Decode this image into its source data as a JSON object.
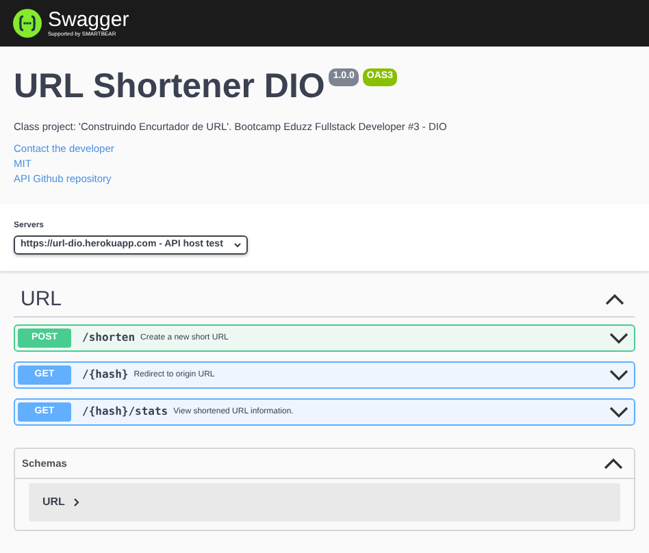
{
  "header": {
    "brand": "Swagger",
    "tagline": "Supported by SMARTBEAR"
  },
  "info": {
    "title": "URL Shortener DIO",
    "version": "1.0.0",
    "spec": "OAS3",
    "description": "Class project: 'Construindo Encurtador de URL'. Bootcamp Eduzz Fullstack Developer #3 - DIO",
    "links": [
      "Contact the developer",
      "MIT",
      "API Github repository"
    ]
  },
  "servers": {
    "label": "Servers",
    "value": "https://url-dio.herokuapp.com - API host test"
  },
  "tags": [
    {
      "name": "URL",
      "expanded": true,
      "operations": [
        {
          "kind": "post",
          "method": "POST",
          "path": "/shorten",
          "summary": "Create a new short URL",
          "expanded": false
        },
        {
          "kind": "get",
          "method": "GET",
          "path": "/{hash}",
          "summary": "Redirect to origin URL",
          "expanded": false
        },
        {
          "kind": "get",
          "method": "GET",
          "path": "/{hash}/stats",
          "summary": "View shortened URL information.",
          "expanded": false
        }
      ]
    }
  ],
  "schemas": {
    "title": "Schemas",
    "expanded": true,
    "models": [
      {
        "name": "URL",
        "expanded": false
      }
    ]
  }
}
